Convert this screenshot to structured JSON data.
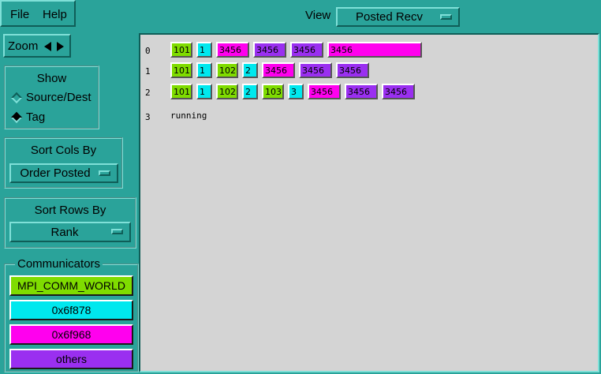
{
  "menu": {
    "file": "File",
    "help": "Help"
  },
  "view": {
    "label": "View",
    "value": "Posted Recv"
  },
  "zoom": {
    "label": "Zoom"
  },
  "show": {
    "title": "Show",
    "options": [
      "Source/Dest",
      "Tag"
    ],
    "selected": "Tag"
  },
  "sort_cols": {
    "title": "Sort Cols By",
    "value": "Order Posted"
  },
  "sort_rows": {
    "title": "Sort Rows By",
    "value": "Rank"
  },
  "communicators": {
    "title": "Communicators",
    "items": [
      {
        "label": "MPI_COMM_WORLD",
        "color": "#7fdc00"
      },
      {
        "label": "0x6f878",
        "color": "#00e8ee"
      },
      {
        "label": "0x6f968",
        "color": "#ff00ee"
      },
      {
        "label": "others",
        "color": "#9a2ff0"
      }
    ]
  },
  "colors": {
    "background": "#2aa39a",
    "canvas": "#d4d4d4",
    "world": "#7fdc00",
    "cyan": "#00e8ee",
    "magenta": "#ff00ee",
    "purple": "#9a2ff0"
  },
  "rows": [
    {
      "label": "0",
      "cells": [
        {
          "text": "101",
          "comm": "world"
        },
        {
          "text": "1",
          "comm": "cyan"
        },
        {
          "text": "3456",
          "comm": "magenta"
        },
        {
          "text": "3456",
          "comm": "purple"
        },
        {
          "text": "3456",
          "comm": "purple"
        },
        {
          "text": "3456",
          "comm": "magenta"
        }
      ]
    },
    {
      "label": "1",
      "cells": [
        {
          "text": "101",
          "comm": "world"
        },
        {
          "text": "1",
          "comm": "cyan"
        },
        {
          "text": "102",
          "comm": "world"
        },
        {
          "text": "2",
          "comm": "cyan"
        },
        {
          "text": "3456",
          "comm": "magenta"
        },
        {
          "text": "3456",
          "comm": "purple"
        },
        {
          "text": "3456",
          "comm": "purple"
        }
      ]
    },
    {
      "label": "2",
      "cells": [
        {
          "text": "101",
          "comm": "world"
        },
        {
          "text": "1",
          "comm": "cyan"
        },
        {
          "text": "102",
          "comm": "world"
        },
        {
          "text": "2",
          "comm": "cyan"
        },
        {
          "text": "103",
          "comm": "world"
        },
        {
          "text": "3",
          "comm": "cyan"
        },
        {
          "text": "3456",
          "comm": "magenta"
        },
        {
          "text": "3456",
          "comm": "purple"
        },
        {
          "text": "3456",
          "comm": "purple"
        }
      ]
    },
    {
      "label": "3",
      "status": "running"
    }
  ]
}
